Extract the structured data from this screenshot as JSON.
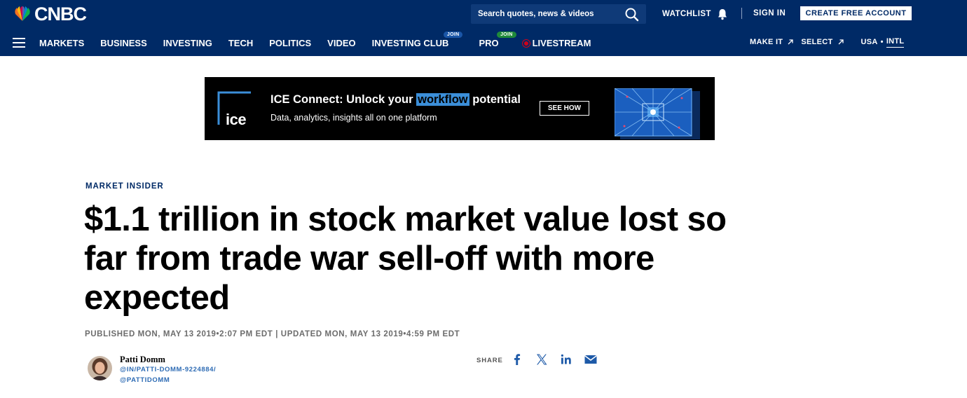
{
  "header": {
    "logo_text": "CNBC",
    "search": {
      "placeholder": "Search quotes, news & videos"
    },
    "watchlist_label": "WATCHLIST",
    "signin_label": "SIGN IN",
    "create_account_label": "CREATE FREE ACCOUNT",
    "nav": {
      "items": [
        {
          "label": "MARKETS"
        },
        {
          "label": "BUSINESS"
        },
        {
          "label": "INVESTING"
        },
        {
          "label": "TECH"
        },
        {
          "label": "POLITICS"
        },
        {
          "label": "VIDEO"
        },
        {
          "label": "INVESTING CLUB",
          "badge": "JOIN"
        },
        {
          "label": "PRO",
          "badge": "JOIN"
        },
        {
          "label": "LIVESTREAM"
        }
      ]
    },
    "right_nav": {
      "make_it": "MAKE IT",
      "select": "SELECT",
      "usa": "USA",
      "separator": "•",
      "intl": "INTL"
    }
  },
  "ad": {
    "logo_text": "ice",
    "headline_before": "ICE Connect: Unlock your ",
    "headline_highlight": "workflow",
    "headline_after": " potential",
    "subline": "Data, analytics, insights all on one platform",
    "cta_label": "SEE HOW"
  },
  "article": {
    "kicker": "MARKET INSIDER",
    "headline": "$1.1 trillion in stock market value lost so far from trade war sell-off with more expected",
    "dates": "PUBLISHED MON, MAY 13 2019•2:07 PM EDT | UPDATED MON, MAY 13 2019•4:59 PM EDT",
    "author": {
      "name": "Patti Domm",
      "linkedin": "@IN/PATTI-DOMM-9224884/",
      "twitter": "@PATTIDOMM"
    },
    "share_label": "SHARE"
  },
  "colors": {
    "header_bg": "#002a66",
    "kicker": "#002a66",
    "link_blue": "#2d6bb4",
    "ad_highlight": "#3b8ed8",
    "join_investing_club": "#1a56a8",
    "join_pro": "#1f8a3a",
    "live_dot": "#d0021b"
  }
}
